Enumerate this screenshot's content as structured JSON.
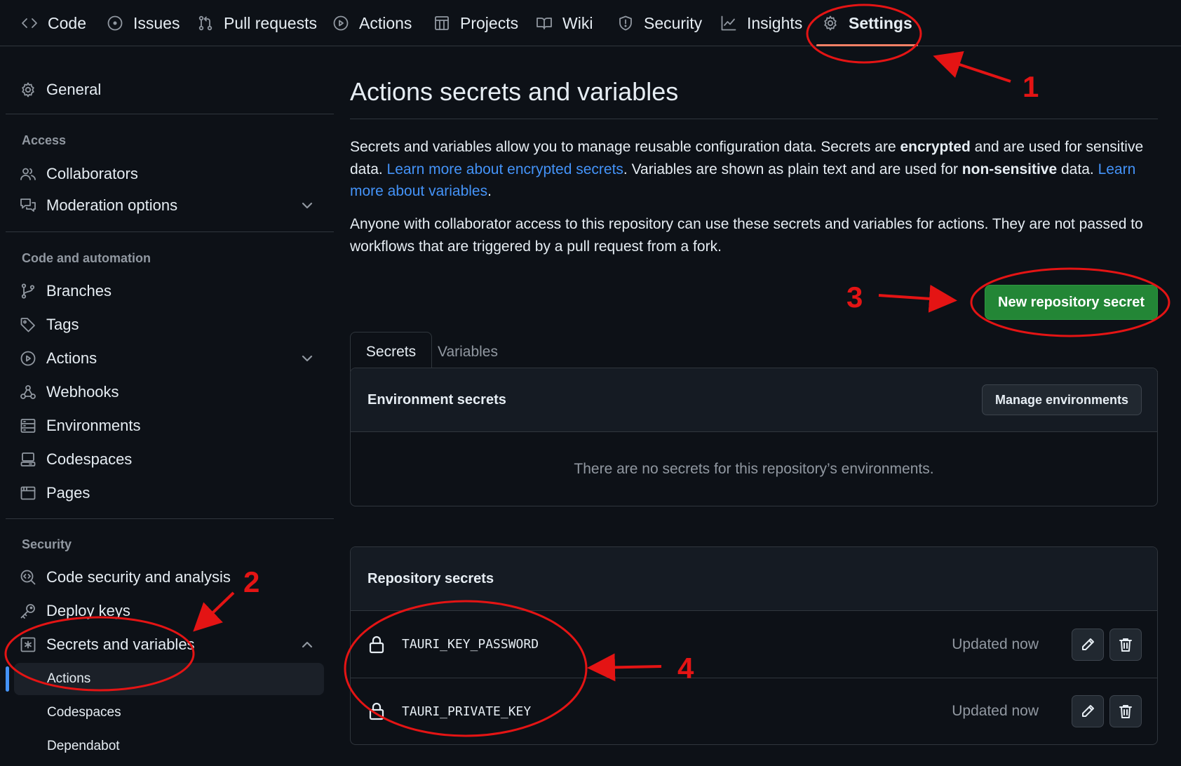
{
  "topnav": {
    "items": [
      {
        "label": "Code",
        "icon": "code-icon"
      },
      {
        "label": "Issues",
        "icon": "issue-icon"
      },
      {
        "label": "Pull requests",
        "icon": "pull-request-icon"
      },
      {
        "label": "Actions",
        "icon": "play-icon"
      },
      {
        "label": "Projects",
        "icon": "table-icon"
      },
      {
        "label": "Wiki",
        "icon": "book-icon"
      },
      {
        "label": "Security",
        "icon": "shield-icon"
      },
      {
        "label": "Insights",
        "icon": "graph-icon"
      },
      {
        "label": "Settings",
        "icon": "gear-icon",
        "active": true
      }
    ]
  },
  "sidebar": {
    "general": "General",
    "access_heading": "Access",
    "collaborators": "Collaborators",
    "moderation": "Moderation options",
    "code_heading": "Code and automation",
    "branches": "Branches",
    "tags": "Tags",
    "actions": "Actions",
    "webhooks": "Webhooks",
    "environments": "Environments",
    "codespaces": "Codespaces",
    "pages": "Pages",
    "security_heading": "Security",
    "code_security": "Code security and analysis",
    "deploy_keys": "Deploy keys",
    "secrets": "Secrets and variables",
    "sub_actions": "Actions",
    "sub_codespaces": "Codespaces",
    "sub_dependabot": "Dependabot"
  },
  "main": {
    "title": "Actions secrets and variables",
    "intro": {
      "p1_a": "Secrets and variables allow you to manage reusable configuration data. Secrets are ",
      "p1_b": "encrypted",
      "p1_c": " and are used for sensitive data. ",
      "p1_link1": "Learn more about encrypted secrets",
      "p1_d": ". Variables are shown as plain text and are used for ",
      "p1_e": "non-sensitive",
      "p1_f": " data. ",
      "p1_link2": "Learn more about variables",
      "p1_g": ".",
      "p2": "Anyone with collaborator access to this repository can use these secrets and variables for actions. They are not passed to workflows that are triggered by a pull request from a fork."
    },
    "tabs": {
      "secrets": "Secrets",
      "variables": "Variables"
    },
    "new_secret_button": "New repository secret",
    "env_secrets": {
      "title": "Environment secrets",
      "manage_button": "Manage environments",
      "empty": "There are no secrets for this repository’s environments."
    },
    "repo_secrets": {
      "title": "Repository secrets",
      "rows": [
        {
          "name": "TAURI_KEY_PASSWORD",
          "updated": "Updated now"
        },
        {
          "name": "TAURI_PRIVATE_KEY",
          "updated": "Updated now"
        }
      ]
    }
  },
  "annotations": {
    "n1": "1",
    "n2": "2",
    "n3": "3",
    "n4": "4"
  },
  "colors": {
    "accent": "#f78166",
    "primary_button": "#238636",
    "link": "#4493f8",
    "annotation": "#e41414"
  }
}
